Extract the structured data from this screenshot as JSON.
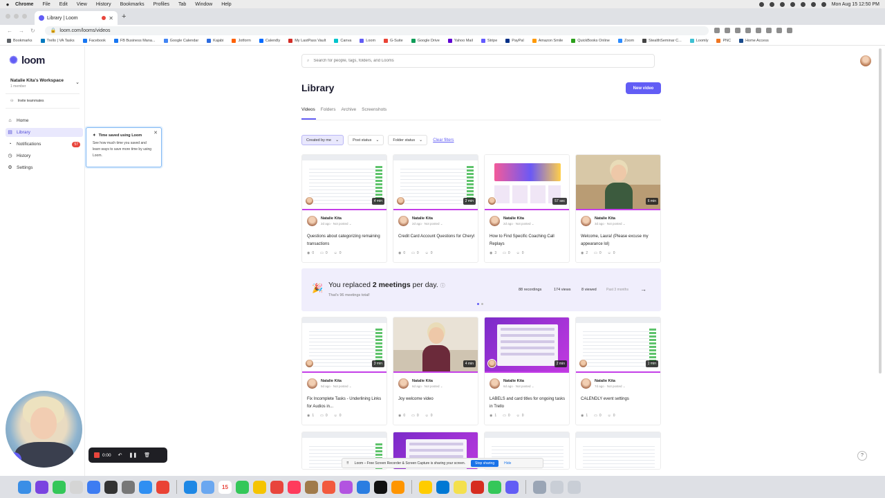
{
  "menubar": {
    "items": [
      "Chrome",
      "File",
      "Edit",
      "View",
      "History",
      "Bookmarks",
      "Profiles",
      "Tab",
      "Window",
      "Help"
    ],
    "clock": "Mon Aug 15  12:50 PM"
  },
  "browser": {
    "tab_title": "Library | Loom",
    "url": "loom.com/looms/videos",
    "bookmarks": [
      {
        "label": "Bookmarks",
        "color": "#5f6368"
      },
      {
        "label": "Trello | VA Tasks",
        "color": "#0079bf"
      },
      {
        "label": "Facebook",
        "color": "#1877f2"
      },
      {
        "label": "FB Business Mana...",
        "color": "#1877f2"
      },
      {
        "label": "Google Calendar",
        "color": "#4285f4"
      },
      {
        "label": "Kajabi",
        "color": "#2d6cdf"
      },
      {
        "label": "Jotform",
        "color": "#ff6100"
      },
      {
        "label": "Calendly",
        "color": "#006bff"
      },
      {
        "label": "My LastPass Vault",
        "color": "#d32d27"
      },
      {
        "label": "Canva",
        "color": "#00c4cc"
      },
      {
        "label": "Loom",
        "color": "#625df5"
      },
      {
        "label": "G-Suite",
        "color": "#ea4335"
      },
      {
        "label": "Google Drive",
        "color": "#0f9d58"
      },
      {
        "label": "Yahoo Mail",
        "color": "#6001d2"
      },
      {
        "label": "Stripe",
        "color": "#635bff"
      },
      {
        "label": "PayPal",
        "color": "#003087"
      },
      {
        "label": "Amazon Smile",
        "color": "#ff9900"
      },
      {
        "label": "QuickBooks Online",
        "color": "#2ca01c"
      },
      {
        "label": "Zoom",
        "color": "#2d8cff"
      },
      {
        "label": "StealthSeminar C...",
        "color": "#444444"
      },
      {
        "label": "Loomly",
        "color": "#3ec1d3"
      },
      {
        "label": "PNC",
        "color": "#ef7622"
      },
      {
        "label": "Home Access",
        "color": "#1a4b8c"
      }
    ]
  },
  "sidebar": {
    "brand": "loom",
    "workspace_name": "Natalie Kita's Workspace",
    "workspace_members": "1 member",
    "invite_label": "Invite teammates",
    "nav": [
      {
        "label": "Home",
        "icon": "home-icon",
        "glyph": "⌂"
      },
      {
        "label": "Library",
        "icon": "library-icon",
        "glyph": "▤"
      },
      {
        "label": "Notifications",
        "icon": "bell-icon",
        "glyph": "◔",
        "badge": "57"
      },
      {
        "label": "History",
        "icon": "history-icon",
        "glyph": "◷"
      },
      {
        "label": "Settings",
        "icon": "gear-icon",
        "glyph": "⚙"
      }
    ]
  },
  "tip": {
    "title": "Time saved using Loom",
    "body": "See how much time you saved and learn ways to save more time by using Loom."
  },
  "main": {
    "search_placeholder": "Search for people, tags, folders, and Looms",
    "title": "Library",
    "new_video_label": "New video",
    "tabs": [
      "Videos",
      "Folders",
      "Archive",
      "Screenshots"
    ],
    "filters": [
      "Created by me",
      "Post status",
      "Folder status"
    ],
    "clear_filters": "Clear filters"
  },
  "videos": [
    {
      "title": "Questions about categorizing remaining transactions",
      "author": "Natalie Kita",
      "when": "2d ago",
      "status": "Not posted",
      "duration": "4 min",
      "views": "0",
      "comments": "0",
      "reactions": "0",
      "thumb": "screen"
    },
    {
      "title": "Credit Card Account Questions for Cheryl",
      "author": "Natalie Kita",
      "when": "2d ago",
      "status": "Not posted",
      "duration": "2 min",
      "views": "0",
      "comments": "0",
      "reactions": "0",
      "thumb": "screen"
    },
    {
      "title": "How to Find Specific Coaching Call Replays",
      "author": "Natalie Kita",
      "when": "2d ago",
      "status": "Not posted",
      "duration": "57 sec",
      "views": "3",
      "comments": "0",
      "reactions": "0",
      "thumb": "banner"
    },
    {
      "title": "Welcome, Laura! (Please excuse my appearance lol)",
      "author": "Natalie Kita",
      "when": "3d ago",
      "status": "Not posted",
      "duration": "6 min",
      "views": "2",
      "comments": "0",
      "reactions": "0",
      "thumb": "photo"
    },
    {
      "title": "Fix Incomplete Tasks - Underlining Links for Audios in...",
      "author": "Natalie Kita",
      "when": "5d ago",
      "status": "Not posted",
      "duration": "3 min",
      "views": "1",
      "comments": "0",
      "reactions": "0",
      "thumb": "screen"
    },
    {
      "title": "Joy welcome video",
      "author": "Natalie Kita",
      "when": "6d ago",
      "status": "Not posted",
      "duration": "4 min",
      "views": "0",
      "comments": "0",
      "reactions": "0",
      "thumb": "photo2"
    },
    {
      "title": "LABELS and card titles for ongoing tasks in Trello",
      "author": "Natalie Kita",
      "when": "6d ago",
      "status": "Not posted",
      "duration": "2 min",
      "views": "1",
      "comments": "0",
      "reactions": "0",
      "thumb": "purple"
    },
    {
      "title": "CALENDLY event settings",
      "author": "Natalie Kita",
      "when": "7d ago",
      "status": "Not posted",
      "duration": "1 min",
      "views": "1",
      "comments": "0",
      "reactions": "0",
      "thumb": "screen"
    }
  ],
  "insight": {
    "headline_prefix": "You replaced ",
    "headline_bold": "2 meetings",
    "headline_suffix": " per day.",
    "subtext": "That's 96 meetings total!",
    "recordings": "88 recordings",
    "views": "174 views",
    "viewed": "8 viewed",
    "period": "Past 3 months"
  },
  "recorder": {
    "time": "0:00"
  },
  "sharing": {
    "message": "Loom – Free Screen Recorder & Screen Capture is sharing your screen.",
    "stop_label": "Stop sharing",
    "hide_label": "Hide"
  },
  "dock": {
    "calendar_day": "15"
  }
}
